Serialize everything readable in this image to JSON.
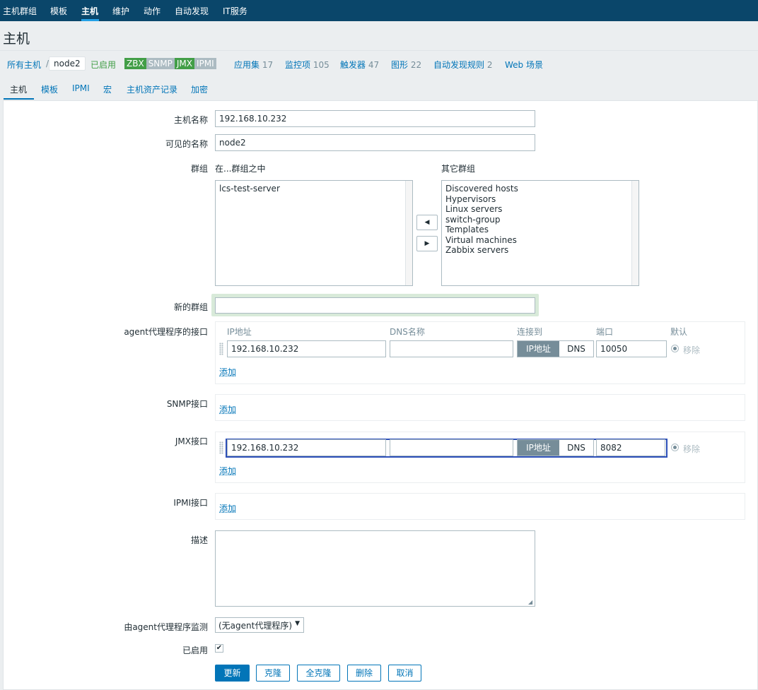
{
  "topnav": {
    "items": [
      "主机群组",
      "模板",
      "主机",
      "维护",
      "动作",
      "自动发现",
      "IT服务"
    ]
  },
  "page": {
    "title": "主机"
  },
  "breadcrumbs": {
    "all_hosts": "所有主机",
    "separator": "/",
    "host": "node2",
    "status": "已启用",
    "badges": [
      {
        "label": "ZBX",
        "color": "#429e47"
      },
      {
        "label": "SNMP",
        "color": "#acbbc2"
      },
      {
        "label": "JMX",
        "color": "#429e47"
      },
      {
        "label": "IPMI",
        "color": "#acbbc2"
      }
    ],
    "links": [
      {
        "label": "应用集",
        "count": "17"
      },
      {
        "label": "监控项",
        "count": "105"
      },
      {
        "label": "触发器",
        "count": "47"
      },
      {
        "label": "图形",
        "count": "22"
      },
      {
        "label": "自动发现规则",
        "count": "2"
      },
      {
        "label": "Web 场景",
        "count": ""
      }
    ]
  },
  "tabs": [
    "主机",
    "模板",
    "IPMI",
    "宏",
    "主机资产记录",
    "加密"
  ],
  "form": {
    "hostname_label": "主机名称",
    "hostname_value": "192.168.10.232",
    "visible_name_label": "可见的名称",
    "visible_name_value": "node2",
    "groups_label": "群组",
    "in_groups_header": "在...群组之中",
    "other_groups_header": "其它群组",
    "in_groups": [
      "lcs-test-server"
    ],
    "other_groups": [
      "Discovered hosts",
      "Hypervisors",
      "Linux servers",
      "switch-group",
      "Templates",
      "Virtual machines",
      "Zabbix servers"
    ],
    "new_group_label": "新的群组",
    "new_group_value": "",
    "agent_label": "agent代理程序的接口",
    "iface_headers": {
      "ip": "IP地址",
      "dns": "DNS名称",
      "connect": "连接到",
      "port": "端口",
      "default": "默认"
    },
    "agent_iface": {
      "ip": "192.168.10.232",
      "dns": "",
      "connect_ip": "IP地址",
      "connect_dns": "DNS",
      "port": "10050",
      "remove": "移除"
    },
    "add_label": "添加",
    "snmp_label": "SNMP接口",
    "jmx_label": "JMX接口",
    "jmx_iface": {
      "ip": "192.168.10.232",
      "dns": "",
      "connect_ip": "IP地址",
      "connect_dns": "DNS",
      "port": "8082",
      "remove": "移除"
    },
    "ipmi_label": "IPMI接口",
    "description_label": "描述",
    "description_value": "",
    "proxy_label": "由agent代理程序监测",
    "proxy_value": "(无agent代理程序)",
    "enabled_label": "已启用",
    "enabled_check": "✔"
  },
  "buttons": {
    "update": "更新",
    "clone": "克隆",
    "full_clone": "全克隆",
    "delete": "删除",
    "cancel": "取消"
  },
  "colors": {
    "topnav_bg": "#0a466a",
    "link": "#0275b8",
    "enabled_green": "#429e47",
    "focus_border": "#2c4fb8"
  }
}
